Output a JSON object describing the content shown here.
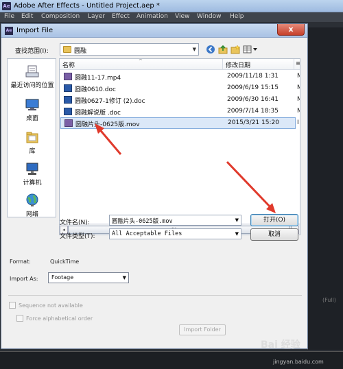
{
  "app": {
    "title": "Adobe After Effects - Untitled Project.aep *",
    "logo": "Ae",
    "menu": [
      "File",
      "Edit",
      "Composition",
      "Layer",
      "Effect",
      "Animation",
      "View",
      "Window",
      "Help"
    ]
  },
  "dialog": {
    "title": "Import File",
    "logo": "Ae",
    "close_label": "x",
    "look_in_label": "查找范围(I):",
    "look_in_value": "圆融",
    "toolbar": [
      "back-icon",
      "up-folder-icon",
      "new-folder-icon",
      "view-menu-icon"
    ],
    "places": [
      {
        "label": "最近访问的位置",
        "icon": "recent-places-icon"
      },
      {
        "label": "桌面",
        "icon": "desktop-icon"
      },
      {
        "label": "库",
        "icon": "libraries-icon"
      },
      {
        "label": "计算机",
        "icon": "computer-icon"
      },
      {
        "label": "网络",
        "icon": "network-icon"
      }
    ],
    "columns": {
      "name": "名称",
      "modified": "修改日期",
      "extra": "≡"
    },
    "files": [
      {
        "name": "圆融11-17.mp4",
        "date": "2009/11/18 1:31",
        "extra": "M",
        "icon": "video-file-icon"
      },
      {
        "name": "圆融0610.doc",
        "date": "2009/6/19 15:15",
        "extra": "M",
        "icon": "doc-file-icon"
      },
      {
        "name": "圆融0627-1修订 (2).doc",
        "date": "2009/6/30 16:41",
        "extra": "M",
        "icon": "doc-file-icon"
      },
      {
        "name": "圆融解说版 .doc",
        "date": "2009/7/14 18:35",
        "extra": "M",
        "icon": "doc-file-icon"
      },
      {
        "name": "圆融片头-0625版.mov",
        "date": "2015/3/21 15:20",
        "extra": "I",
        "icon": "video-file-icon",
        "selected": true
      }
    ],
    "scroll": {
      "left_arrow": "◂",
      "right_arrow": "▸",
      "grip": "|||"
    },
    "file_name_label": "文件名(N):",
    "file_name_value": "圆融片头-0625版.mov",
    "file_type_label": "文件类型(T):",
    "file_type_value": "All Acceptable Files",
    "open_button": "打开(O)",
    "cancel_button": "取消",
    "format_label": "Format:",
    "format_value": "QuickTime",
    "import_as_label": "Import As:",
    "import_as_value": "Footage",
    "sequence_label": "Sequence not available",
    "force_alpha_label": "Force alphabetical order",
    "import_folder_button": "Import Folder"
  },
  "background": {
    "full_label": "(Full)"
  },
  "watermark": {
    "text": "Bai 经验",
    "url": "jingyan.baidu.com"
  },
  "colors": {
    "annotation_arrow": "#e03a2c",
    "selection": "#dbe8f8",
    "menubar": "#3f444c"
  }
}
